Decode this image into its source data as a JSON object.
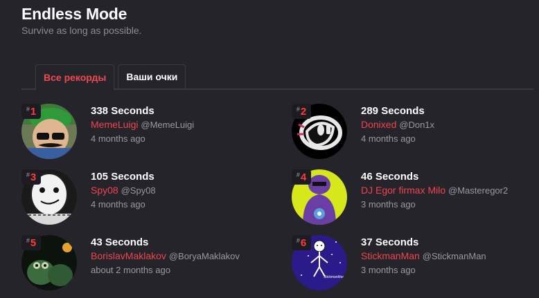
{
  "header": {
    "title": "Endless Mode",
    "subtitle": "Survive as long as possible."
  },
  "tabs": [
    {
      "label": "Все рекорды",
      "active": true
    },
    {
      "label": "Ваши очки",
      "active": false
    }
  ],
  "rank_hash": "#",
  "entries": [
    {
      "rank": "1",
      "score": "338 Seconds",
      "name": "MemeLuigi",
      "handle": "@MemeLuigi",
      "time": "4 months ago",
      "avatar_icon": "luigi-avatar-icon"
    },
    {
      "rank": "2",
      "score": "289 Seconds",
      "name": "Donixed",
      "handle": "@Don1x",
      "time": "4 months ago",
      "avatar_icon": "robot-head-avatar-icon"
    },
    {
      "rank": "3",
      "score": "105 Seconds",
      "name": "Spy08",
      "handle": "@Spy08",
      "time": "4 months ago",
      "avatar_icon": "white-mask-avatar-icon"
    },
    {
      "rank": "4",
      "score": "46 Seconds",
      "name": "DJ Egor firmax Milo",
      "handle": "@Masteregor2",
      "time": "3 months ago",
      "avatar_icon": "purple-figure-avatar-icon"
    },
    {
      "rank": "5",
      "score": "43 Seconds",
      "name": "BorislavMaklakov",
      "handle": "@BoryaMaklakov",
      "time": "about 2 months ago",
      "avatar_icon": "frogs-avatar-icon"
    },
    {
      "rank": "6",
      "score": "37 Seconds",
      "name": "StickmanMan",
      "handle": "@StickmanMan",
      "time": "3 months ago",
      "avatar_icon": "stickman-avatar-icon",
      "avatar_caption": "StickmanMan"
    }
  ],
  "colors": {
    "background": "#25242b",
    "accent": "#f0454c",
    "rank": "#ff3b3b",
    "muted": "#9a99a2"
  }
}
